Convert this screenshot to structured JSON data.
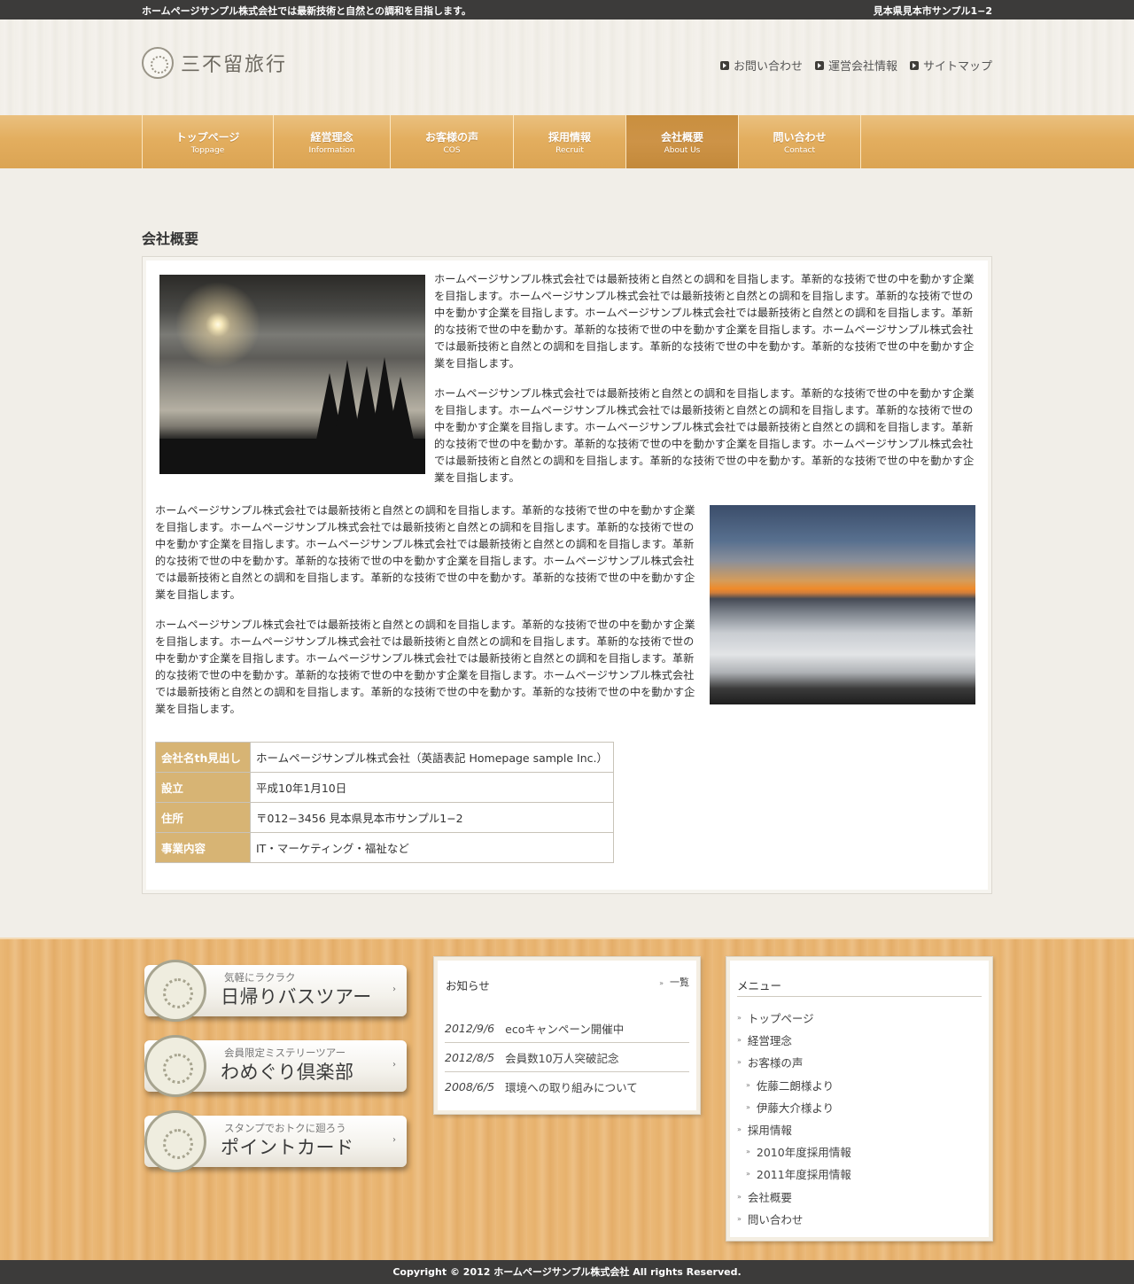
{
  "topbar": {
    "tagline": "ホームページサンプル株式会社では最新技術と自然との調和を目指します。",
    "address": "見本県見本市サンプル1−2"
  },
  "header": {
    "logo_text": "三不留旅行",
    "logo_icon": "flower-crest-icon",
    "util_links": [
      "お問い合わせ",
      "運営会社情報",
      "サイトマップ"
    ]
  },
  "nav": {
    "items": [
      {
        "ja": "トップページ",
        "en": "Toppage"
      },
      {
        "ja": "経営理念",
        "en": "Information"
      },
      {
        "ja": "お客様の声",
        "en": "COS"
      },
      {
        "ja": "採用情報",
        "en": "Recruit"
      },
      {
        "ja": "会社概要",
        "en": "About Us"
      },
      {
        "ja": "問い合わせ",
        "en": "Contact"
      }
    ],
    "active_index": 4
  },
  "main": {
    "page_title": "会社概要",
    "paragraphs": [
      "ホームページサンプル株式会社では最新技術と自然との調和を目指します。革新的な技術で世の中を動かす企業を目指します。ホームページサンプル株式会社では最新技術と自然との調和を目指します。革新的な技術で世の中を動かす企業を目指します。ホームページサンプル株式会社では最新技術と自然との調和を目指します。革新的な技術で世の中を動かす。革新的な技術で世の中を動かす企業を目指します。ホームページサンプル株式会社では最新技術と自然との調和を目指します。革新的な技術で世の中を動かす。革新的な技術で世の中を動かす企業を目指します。",
      "ホームページサンプル株式会社では最新技術と自然との調和を目指します。革新的な技術で世の中を動かす企業を目指します。ホームページサンプル株式会社では最新技術と自然との調和を目指します。革新的な技術で世の中を動かす企業を目指します。ホームページサンプル株式会社では最新技術と自然との調和を目指します。革新的な技術で世の中を動かす。革新的な技術で世の中を動かす企業を目指します。ホームページサンプル株式会社では最新技術と自然との調和を目指します。革新的な技術で世の中を動かす。革新的な技術で世の中を動かす企業を目指します。",
      "ホームページサンプル株式会社では最新技術と自然との調和を目指します。革新的な技術で世の中を動かす企業を目指します。ホームページサンプル株式会社では最新技術と自然との調和を目指します。革新的な技術で世の中を動かす企業を目指します。ホームページサンプル株式会社では最新技術と自然との調和を目指します。革新的な技術で世の中を動かす。革新的な技術で世の中を動かす企業を目指します。ホームページサンプル株式会社では最新技術と自然との調和を目指します。革新的な技術で世の中を動かす。革新的な技術で世の中を動かす企業を目指します。",
      "ホームページサンプル株式会社では最新技術と自然との調和を目指します。革新的な技術で世の中を動かす企業を目指します。ホームページサンプル株式会社では最新技術と自然との調和を目指します。革新的な技術で世の中を動かす企業を目指します。ホームページサンプル株式会社では最新技術と自然との調和を目指します。革新的な技術で世の中を動かす。革新的な技術で世の中を動かす企業を目指します。ホームページサンプル株式会社では最新技術と自然との調和を目指します。革新的な技術で世の中を動かす。革新的な技術で世の中を動かす企業を目指します。"
    ],
    "company_table": [
      {
        "label": "会社名th見出し",
        "value": "ホームページサンプル株式会社（英語表記 Homepage sample Inc.）"
      },
      {
        "label": "設立",
        "value": "平成10年1月10日"
      },
      {
        "label": "住所",
        "value": "〒012−3456 見本県見本市サンプル1−2"
      },
      {
        "label": "事業内容",
        "value": "IT・マーケティング・福祉など"
      }
    ]
  },
  "banners": [
    {
      "small": "気軽にラクラク",
      "big": "日帰りバスツアー"
    },
    {
      "small": "会員限定ミステリーツアー",
      "big": "わめぐり倶楽部"
    },
    {
      "small": "スタンプでおトクに廻ろう",
      "big": "ポイントカード"
    }
  ],
  "news": {
    "title": "お知らせ",
    "list_link": "一覧",
    "items": [
      {
        "date": "2012/9/6",
        "text": "ecoキャンペーン開催中"
      },
      {
        "date": "2012/8/5",
        "text": "会員数10万人突破記念"
      },
      {
        "date": "2008/6/5",
        "text": "環境への取り組みについて"
      }
    ]
  },
  "side_menu": {
    "title": "メニュー",
    "items": [
      {
        "label": "トップページ",
        "sub": false
      },
      {
        "label": "経営理念",
        "sub": false
      },
      {
        "label": "お客様の声",
        "sub": false
      },
      {
        "label": "佐藤二朗様より",
        "sub": true
      },
      {
        "label": "伊藤大介様より",
        "sub": true
      },
      {
        "label": "採用情報",
        "sub": false
      },
      {
        "label": "2010年度採用情報",
        "sub": true
      },
      {
        "label": "2011年度採用情報",
        "sub": true
      },
      {
        "label": "会社概要",
        "sub": false
      },
      {
        "label": "問い合わせ",
        "sub": false
      }
    ]
  },
  "footer": {
    "copyright": "Copyright © 2012 ホームページサンプル株式会社 All rights Reserved."
  },
  "colors": {
    "nav_gold": "#e3ae5f",
    "nav_active": "#c98f3f",
    "table_header": "#d7b474",
    "dark_bar": "#3c3b3a"
  }
}
